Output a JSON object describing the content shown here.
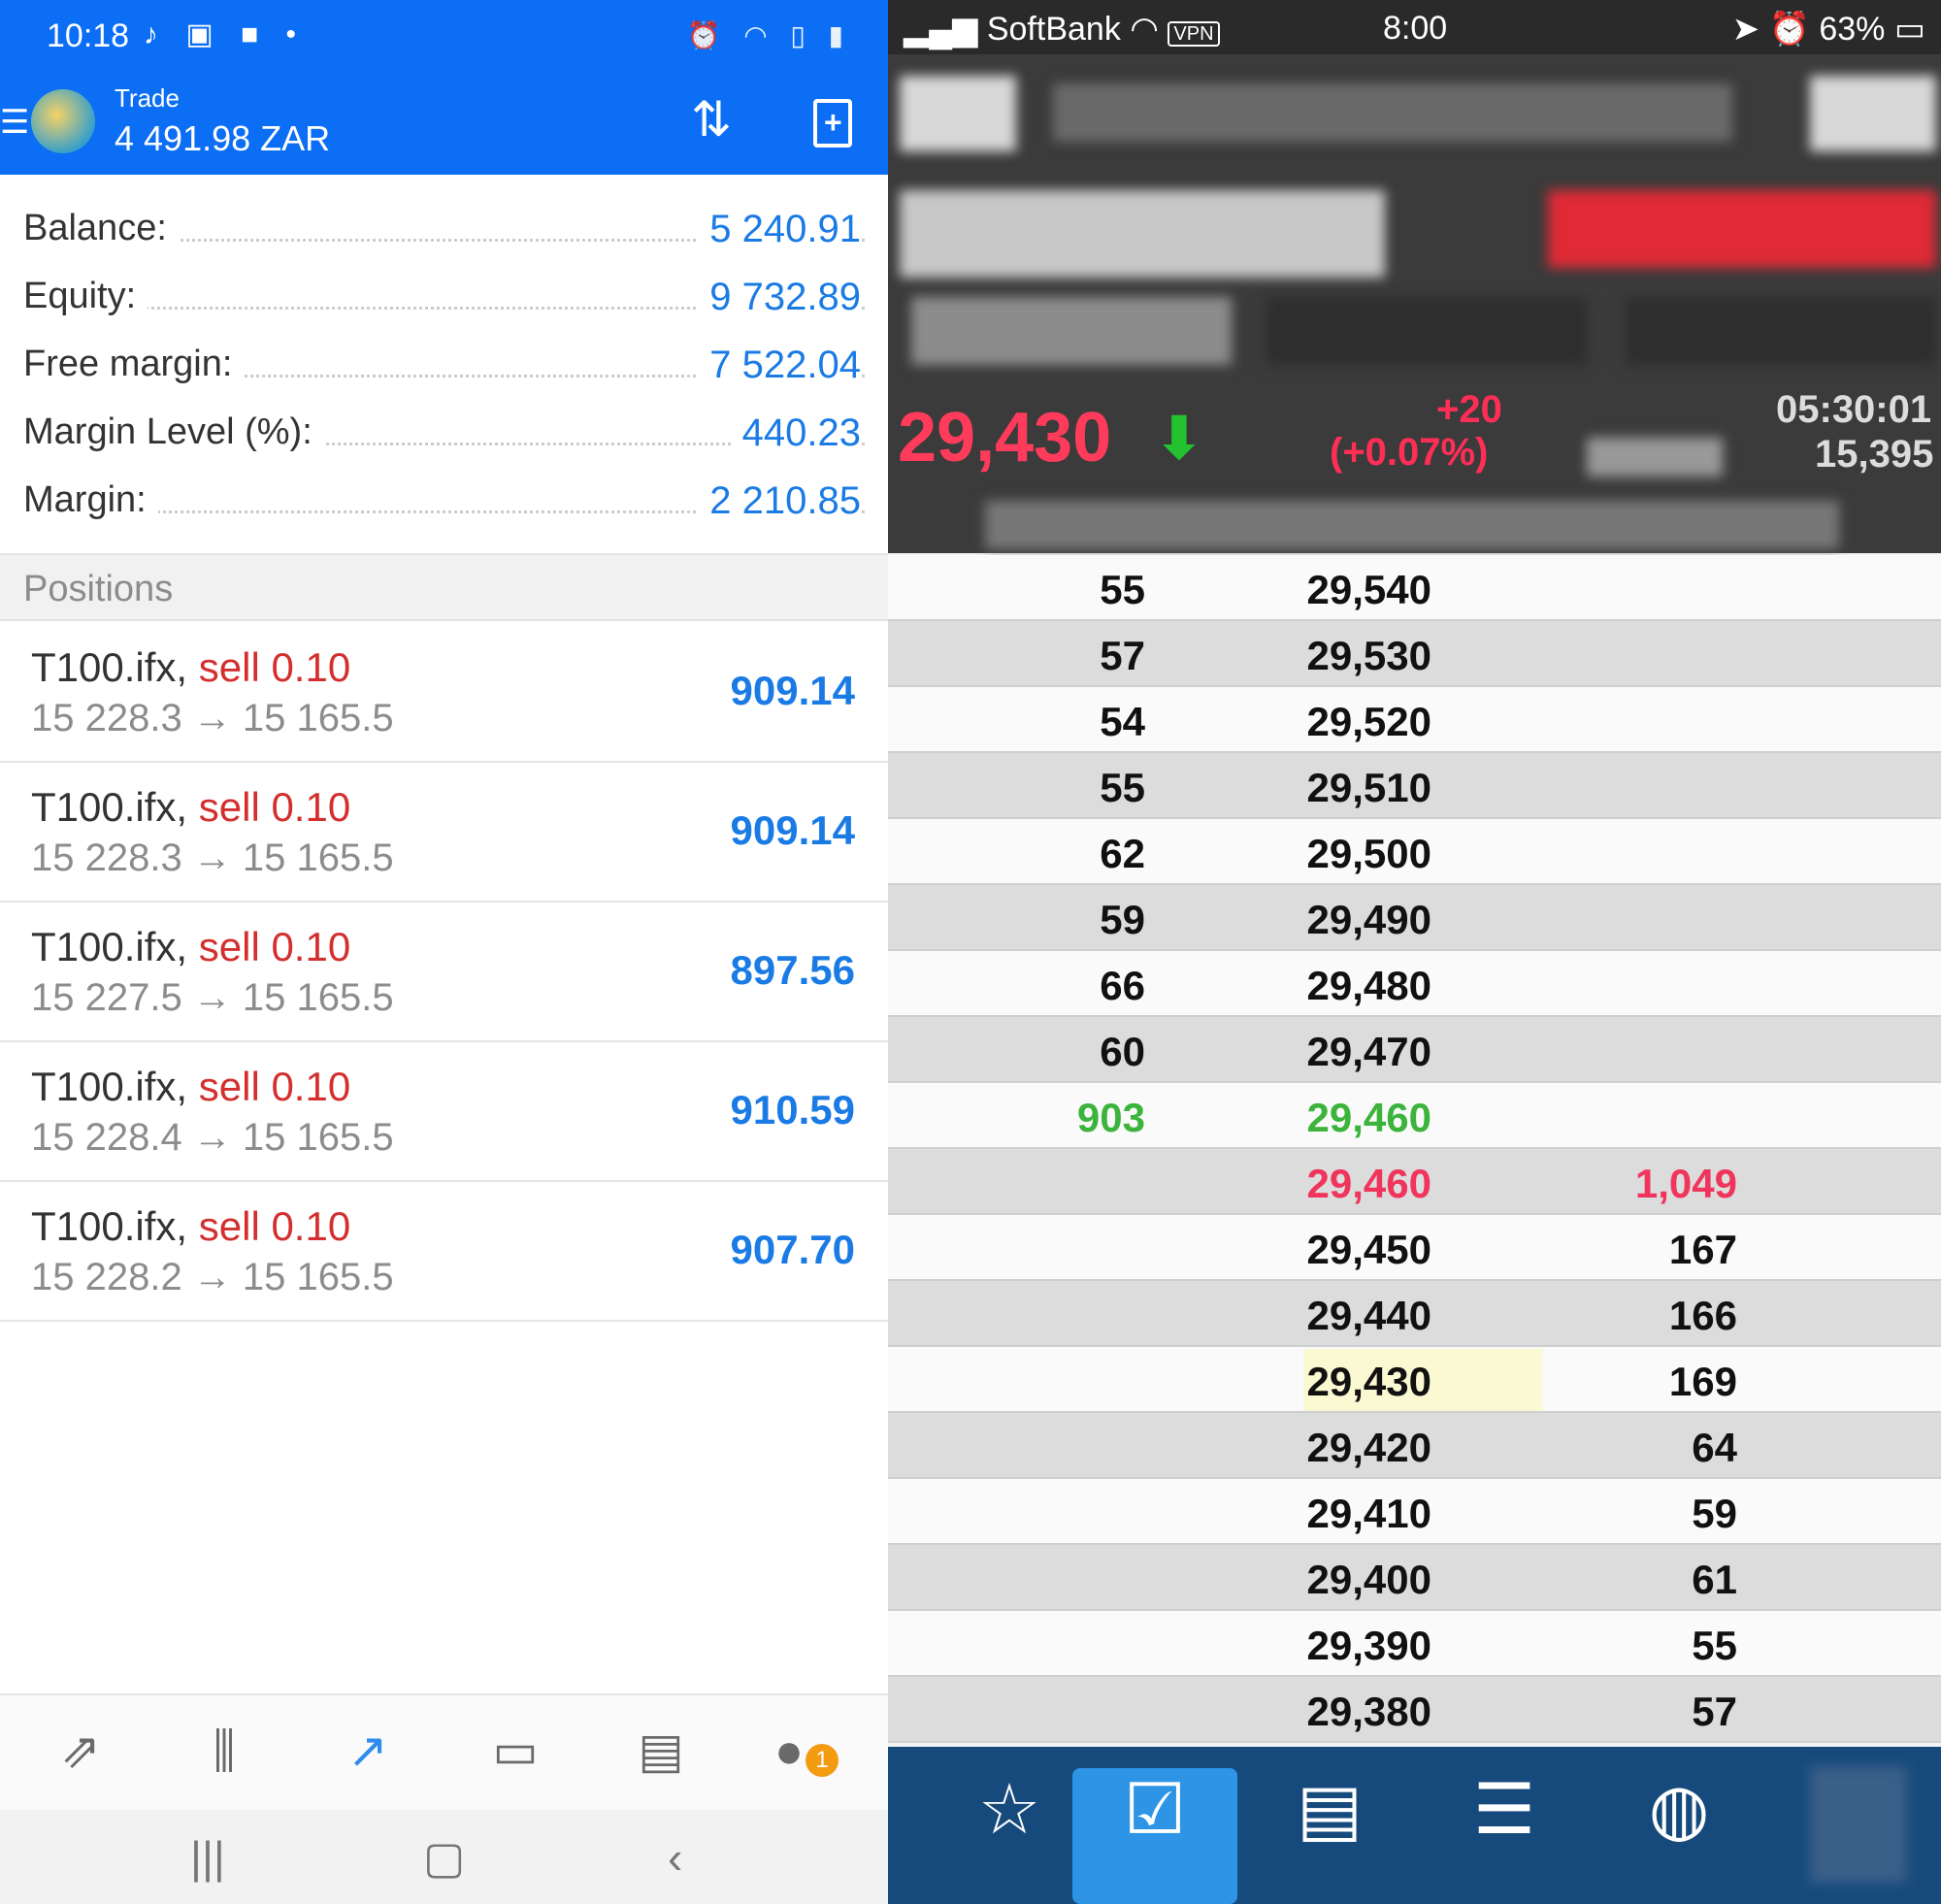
{
  "left": {
    "status_bar": {
      "time": "10:18",
      "icons": [
        "tiktok-icon",
        "image-icon",
        "bag-icon"
      ]
    },
    "app_bar": {
      "title": "Trade",
      "balance": "4 491.98 ZAR"
    },
    "account": [
      {
        "label": "Balance:",
        "value": "5 240.91"
      },
      {
        "label": "Equity:",
        "value": "9 732.89"
      },
      {
        "label": "Free margin:",
        "value": "7 522.04"
      },
      {
        "label": "Margin Level (%):",
        "value": "440.23"
      },
      {
        "label": "Margin:",
        "value": "2 210.85"
      }
    ],
    "positions_header": "Positions",
    "positions": [
      {
        "symbol": "T100.ifx,",
        "side": "sell 0.10",
        "prices": "15 228.3 → 15 165.5",
        "profit": "909.14"
      },
      {
        "symbol": "T100.ifx,",
        "side": "sell 0.10",
        "prices": "15 228.3 → 15 165.5",
        "profit": "909.14"
      },
      {
        "symbol": "T100.ifx,",
        "side": "sell 0.10",
        "prices": "15 227.5 → 15 165.5",
        "profit": "897.56"
      },
      {
        "symbol": "T100.ifx,",
        "side": "sell 0.10",
        "prices": "15 228.4 → 15 165.5",
        "profit": "910.59"
      },
      {
        "symbol": "T100.ifx,",
        "side": "sell 0.10",
        "prices": "15 228.2 → 15 165.5",
        "profit": "907.70"
      }
    ],
    "bottom_nav": [
      "quotes-icon",
      "chart-icon",
      "trade-icon",
      "history-icon",
      "news-icon",
      "chat-icon"
    ],
    "chat_badge": "1"
  },
  "right": {
    "status_bar": {
      "carrier": "SoftBank",
      "vpn": "VPN",
      "time": "8:00",
      "battery": "63%"
    },
    "last_price": "29,430",
    "change": "+20",
    "change_pct": "(+0.07%)",
    "clock": "05:30:01",
    "volume": "15,395",
    "book": [
      {
        "bid": "55",
        "price": "29,540",
        "ask": ""
      },
      {
        "bid": "57",
        "price": "29,530",
        "ask": ""
      },
      {
        "bid": "54",
        "price": "29,520",
        "ask": ""
      },
      {
        "bid": "55",
        "price": "29,510",
        "ask": ""
      },
      {
        "bid": "62",
        "price": "29,500",
        "ask": ""
      },
      {
        "bid": "59",
        "price": "29,490",
        "ask": ""
      },
      {
        "bid": "66",
        "price": "29,480",
        "ask": ""
      },
      {
        "bid": "60",
        "price": "29,470",
        "ask": ""
      },
      {
        "bid": "903",
        "price": "29,460",
        "ask": ""
      },
      {
        "bid": "",
        "price": "29,460",
        "ask": "1,049"
      },
      {
        "bid": "",
        "price": "29,450",
        "ask": "167"
      },
      {
        "bid": "",
        "price": "29,440",
        "ask": "166"
      },
      {
        "bid": "",
        "price": "29,430",
        "ask": "169"
      },
      {
        "bid": "",
        "price": "29,420",
        "ask": "64"
      },
      {
        "bid": "",
        "price": "29,410",
        "ask": "59"
      },
      {
        "bid": "",
        "price": "29,400",
        "ask": "61"
      },
      {
        "bid": "",
        "price": "29,390",
        "ask": "55"
      },
      {
        "bid": "",
        "price": "29,380",
        "ask": "57"
      }
    ],
    "colors": {
      "bid_best": "#3cb43c",
      "ask_best": "#f0345c",
      "highlight": "#fbf9d2"
    },
    "tabs": [
      "star-icon",
      "checkbox-icon",
      "list-doc-icon",
      "list-icon",
      "globe-icon"
    ]
  }
}
